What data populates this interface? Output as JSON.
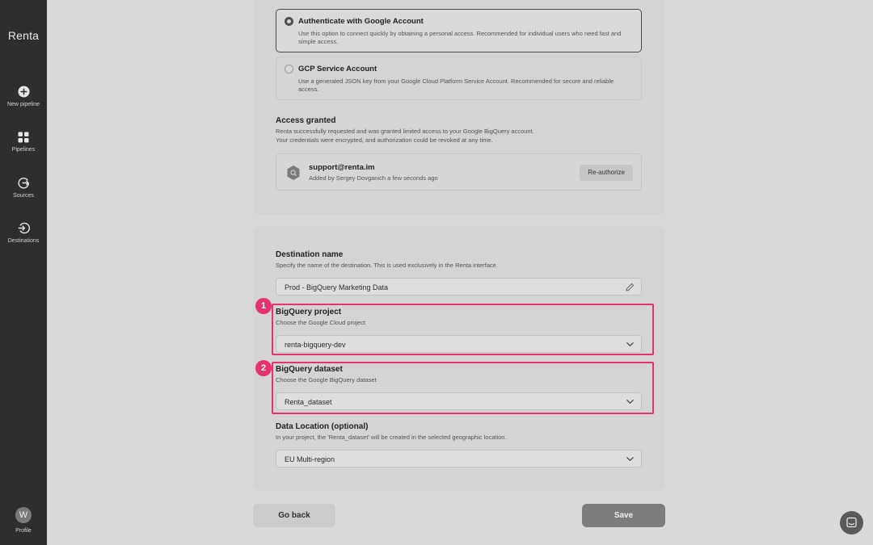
{
  "sidebar": {
    "brand": "Renta",
    "items": [
      {
        "label": "New pipeline",
        "icon": "plus-circle-icon"
      },
      {
        "label": "Pipelines",
        "icon": "grid-icon"
      },
      {
        "label": "Sources",
        "icon": "sources-icon"
      },
      {
        "label": "Destinations",
        "icon": "destinations-icon"
      }
    ],
    "profile": {
      "initial": "W",
      "label": "Profile"
    }
  },
  "auth": {
    "options": [
      {
        "title": "Authenticate with Google Account",
        "description": "Use this option to connect quickly by obtaining a personal access. Recommended for individual users who need fast and simple access.",
        "selected": true
      },
      {
        "title": "GCP Service Account",
        "description": "Use a generated JSON key from your Google Cloud Platform Service Account. Recommended for secure and reliable access.",
        "selected": false
      }
    ],
    "access": {
      "title": "Access granted",
      "description_line1": "Renta successfully requested and was granted limited access to your Google BigQuery account.",
      "description_line2": "Your credentials were encrypted, and authorization could be revoked at any time.",
      "account_email": "support@renta.im",
      "account_added": "Added by Sergey Dovganich a few seconds ago",
      "reauthorize_label": "Re-authorize"
    }
  },
  "destination": {
    "name_title": "Destination name",
    "name_desc": "Specify the name of the destination. This is used exclusively in the Renta interface.",
    "name_value": "Prod - BigQuery Marketing Data",
    "project_title": "BigQuery project",
    "project_desc": "Choose the Google Cloud project",
    "project_value": "renta-bigquery-dev",
    "dataset_title": "BigQuery dataset",
    "dataset_desc": "Choose the Google BigQuery dataset",
    "dataset_value": "Renta_dataset",
    "location_title": "Data Location (optional)",
    "location_desc": "In your project, the 'Renta_dataset' will be created in the selected geographic location.",
    "location_value": "EU Multi-region"
  },
  "markers": [
    "1",
    "2"
  ],
  "actions": {
    "back_label": "Go back",
    "save_label": "Save"
  },
  "colors": {
    "highlight": "#e6336f",
    "sidebar": "#2e2e2e"
  }
}
